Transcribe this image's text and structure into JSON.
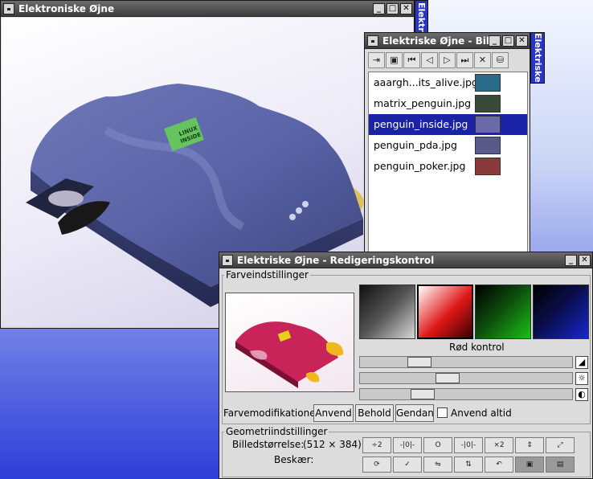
{
  "viewer": {
    "title": "Elektroniske Øjne",
    "shade_tab": "Elektronis",
    "logo_text_1": "LINUX",
    "logo_text_2": "INSIDE",
    "buttons": [
      "_",
      "□",
      "✕"
    ]
  },
  "browser": {
    "title": "Elektriske Øjne - Bille",
    "shade_tab": "Elektriske",
    "buttons": [
      "_",
      "□",
      "✕"
    ],
    "toolbar": [
      {
        "icon": "open-icon",
        "glyph": "⇥"
      },
      {
        "icon": "save-icon",
        "glyph": "▣"
      },
      {
        "icon": "first-icon",
        "glyph": "⏮"
      },
      {
        "icon": "previous-icon",
        "glyph": "◁"
      },
      {
        "icon": "next-icon",
        "glyph": "▷"
      },
      {
        "icon": "last-icon",
        "glyph": "⏭"
      },
      {
        "icon": "close-icon",
        "glyph": "✕"
      },
      {
        "icon": "disk-icon",
        "glyph": "⛁"
      }
    ],
    "files": [
      {
        "name": "aaargh...its_alive.jpg",
        "selected": false,
        "thumb": "#2a6a8a"
      },
      {
        "name": "matrix_penguin.jpg",
        "selected": false,
        "thumb": "#3a4a3a"
      },
      {
        "name": "penguin_inside.jpg",
        "selected": true,
        "thumb": "#6a6aa8"
      },
      {
        "name": "penguin_pda.jpg",
        "selected": false,
        "thumb": "#5a5a8a"
      },
      {
        "name": "penguin_poker.jpg",
        "selected": false,
        "thumb": "#8a3a3a"
      }
    ]
  },
  "editor": {
    "title": "Elektriske Øjne - Redigeringskontrol",
    "buttons": [
      "_",
      "✕"
    ],
    "color_group_label": "Farveindstillinger",
    "channel_label": "Rød kontrol",
    "swatches": [
      {
        "name": "gray",
        "color": "#c8c8c8"
      },
      {
        "name": "red",
        "color": "#e01818"
      },
      {
        "name": "green",
        "color": "#18a818"
      },
      {
        "name": "blue",
        "color": "#1828c8"
      }
    ],
    "sliders": [
      {
        "name": "contrast",
        "value": 0.25,
        "icon": "contrast-icon",
        "glyph": "◢"
      },
      {
        "name": "brightness",
        "value": 0.4,
        "icon": "brightness-icon",
        "glyph": "☼"
      },
      {
        "name": "gamma",
        "value": 0.27,
        "icon": "gamma-icon",
        "glyph": "◐"
      }
    ],
    "mod_label": "Farvemodifikationer:",
    "apply": "Anvend",
    "keep": "Behold",
    "restore": "Gendan",
    "always_apply": "Anvend altid",
    "geom_group_label": "Geometriindstillinger",
    "size_label": "Billedstørrelse:",
    "size_value": "(512 × 384)",
    "crop_label": "Beskær:",
    "geom_buttons_row1": [
      {
        "icon": "half-size-icon",
        "text": "÷2"
      },
      {
        "icon": "shrink-icon",
        "text": "-|0|-"
      },
      {
        "icon": "original-size-icon",
        "text": "O"
      },
      {
        "icon": "enlarge-icon",
        "text": "-|0|-"
      },
      {
        "icon": "double-size-icon",
        "text": "×2"
      },
      {
        "icon": "fit-icon",
        "text": "⇕"
      },
      {
        "icon": "maximize-icon",
        "text": "⤢"
      }
    ],
    "geom_buttons_row2": [
      {
        "icon": "rotate-icon",
        "text": "⟳"
      },
      {
        "icon": "crop-icon",
        "text": "✓"
      },
      {
        "icon": "flip-horizontal-icon",
        "text": "⇋"
      },
      {
        "icon": "flip-vertical-icon",
        "text": "⇅"
      },
      {
        "icon": "undo-icon",
        "text": "↶"
      },
      {
        "icon": "fullscreen-icon",
        "text": "▣",
        "pressed": true
      },
      {
        "icon": "aspect-icon",
        "text": "▤",
        "pressed": true
      }
    ]
  }
}
